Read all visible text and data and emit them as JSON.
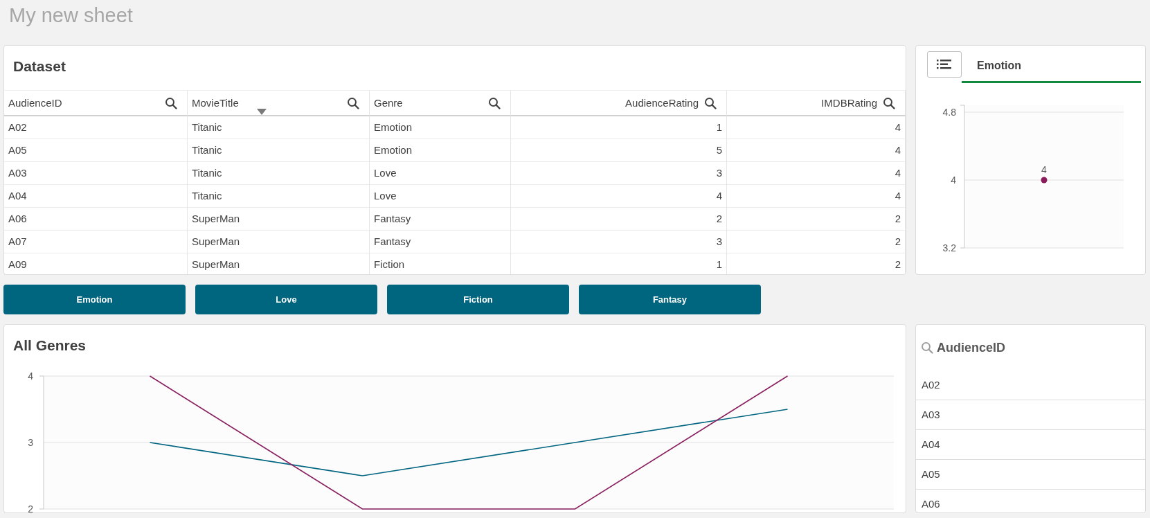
{
  "sheet_title": "My new sheet",
  "dataset": {
    "title": "Dataset",
    "columns": [
      {
        "label": "AudienceID",
        "numeric": false,
        "sorted": false
      },
      {
        "label": "MovieTitle",
        "numeric": false,
        "sorted": true
      },
      {
        "label": "Genre",
        "numeric": false,
        "sorted": false
      },
      {
        "label": "AudienceRating",
        "numeric": true,
        "sorted": false
      },
      {
        "label": "IMDBRating",
        "numeric": true,
        "sorted": false
      }
    ],
    "rows": [
      [
        "A02",
        "Titanic",
        "Emotion",
        "1",
        "4"
      ],
      [
        "A05",
        "Titanic",
        "Emotion",
        "5",
        "4"
      ],
      [
        "A03",
        "Titanic",
        "Love",
        "3",
        "4"
      ],
      [
        "A04",
        "Titanic",
        "Love",
        "4",
        "4"
      ],
      [
        "A06",
        "SuperMan",
        "Fantasy",
        "2",
        "2"
      ],
      [
        "A07",
        "SuperMan",
        "Fantasy",
        "3",
        "2"
      ],
      [
        "A09",
        "SuperMan",
        "Fiction",
        "1",
        "2"
      ]
    ]
  },
  "detail_panel": {
    "tabs": [
      {
        "label": "Emotion",
        "selected": true
      }
    ],
    "chart_data": {
      "type": "scatter",
      "ylim": [
        3.2,
        4.8
      ],
      "yticks": [
        3.2,
        4,
        4.8
      ],
      "data_labels": true,
      "series": [
        {
          "color": "#8a1c5c",
          "values": [
            4
          ]
        }
      ]
    }
  },
  "filter_buttons": [
    "Emotion",
    "Love",
    "Fiction",
    "Fantasy"
  ],
  "all_genres": {
    "title": "All Genres",
    "chart_data": {
      "type": "line",
      "ylim": [
        2,
        4
      ],
      "yticks": [
        2,
        3,
        4
      ],
      "series": [
        {
          "color": "#006580",
          "values": [
            3,
            2.5,
            3,
            3.5
          ]
        },
        {
          "color": "#8a2060",
          "values": [
            4,
            2,
            2,
            4
          ]
        }
      ]
    }
  },
  "filter_list": {
    "title": "AudienceID",
    "items": [
      "A02",
      "A03",
      "A04",
      "A05",
      "A06"
    ]
  }
}
